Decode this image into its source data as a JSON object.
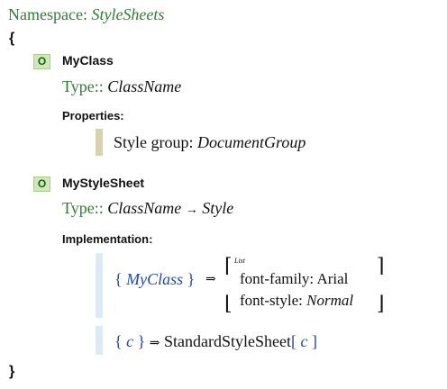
{
  "namespace": {
    "label": "Namespace:",
    "name": "StyleSheets"
  },
  "braces": {
    "open": "{",
    "close": "}"
  },
  "members": [
    {
      "badge": "O",
      "name": "MyClass",
      "type_label": "Type::",
      "type_value": "ClassName",
      "section_label": "Properties:",
      "property": {
        "key": "Style group:",
        "value": "DocumentGroup"
      }
    },
    {
      "badge": "O",
      "name": "MyStyleSheet",
      "type_label": "Type::",
      "type_value": "ClassName",
      "type_arrow": "→",
      "type_result": "Style",
      "section_label": "Implementation:",
      "rule1": {
        "open": "{",
        "pattern": "MyClass",
        "close": "}",
        "arrow": "⇒",
        "list_tag": "List",
        "item1": {
          "key": "font-family:",
          "value": "Arial"
        },
        "item2": {
          "key": "font-style:",
          "value": "Normal"
        }
      },
      "rule2": {
        "open": "{",
        "var": "c",
        "close": "}",
        "arrow": "⇒",
        "call": "StandardStyleSheet",
        "arg_open": "[",
        "arg": "c",
        "arg_close": "]"
      }
    }
  ]
}
